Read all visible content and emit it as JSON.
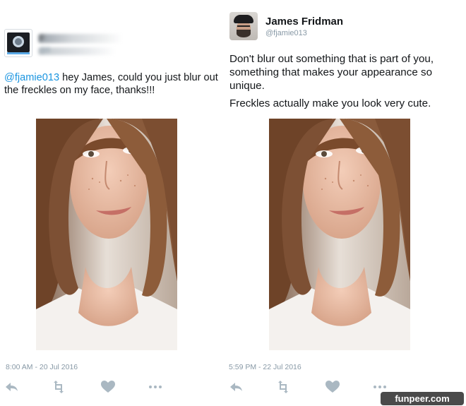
{
  "left_tweet": {
    "author_name": "F",
    "author_handle": "@fi",
    "text_mention": "@fjamie013",
    "text_body": " hey James, could you just blur out the freckles on my face, thanks!!!",
    "timestamp": "8:00 AM - 20 Jul 2016"
  },
  "right_tweet": {
    "author_name": "James Fridman",
    "author_handle": "@fjamie013",
    "paragraph_1": "Don't blur out something that is part of you, something that makes your appearance so unique.",
    "paragraph_2": "Freckles actually make you look very cute.",
    "timestamp": "5:59 PM - 22 Jul 2016"
  },
  "actions": {
    "reply_icon": "reply-icon",
    "retweet_icon": "retweet-icon",
    "like_icon": "heart-icon",
    "more_icon": "more-dots-icon"
  },
  "colors": {
    "mention": "#1b95e0",
    "secondary_text": "#8899a6",
    "action_icon": "#aab8c2"
  },
  "watermark": "funpeer.com"
}
